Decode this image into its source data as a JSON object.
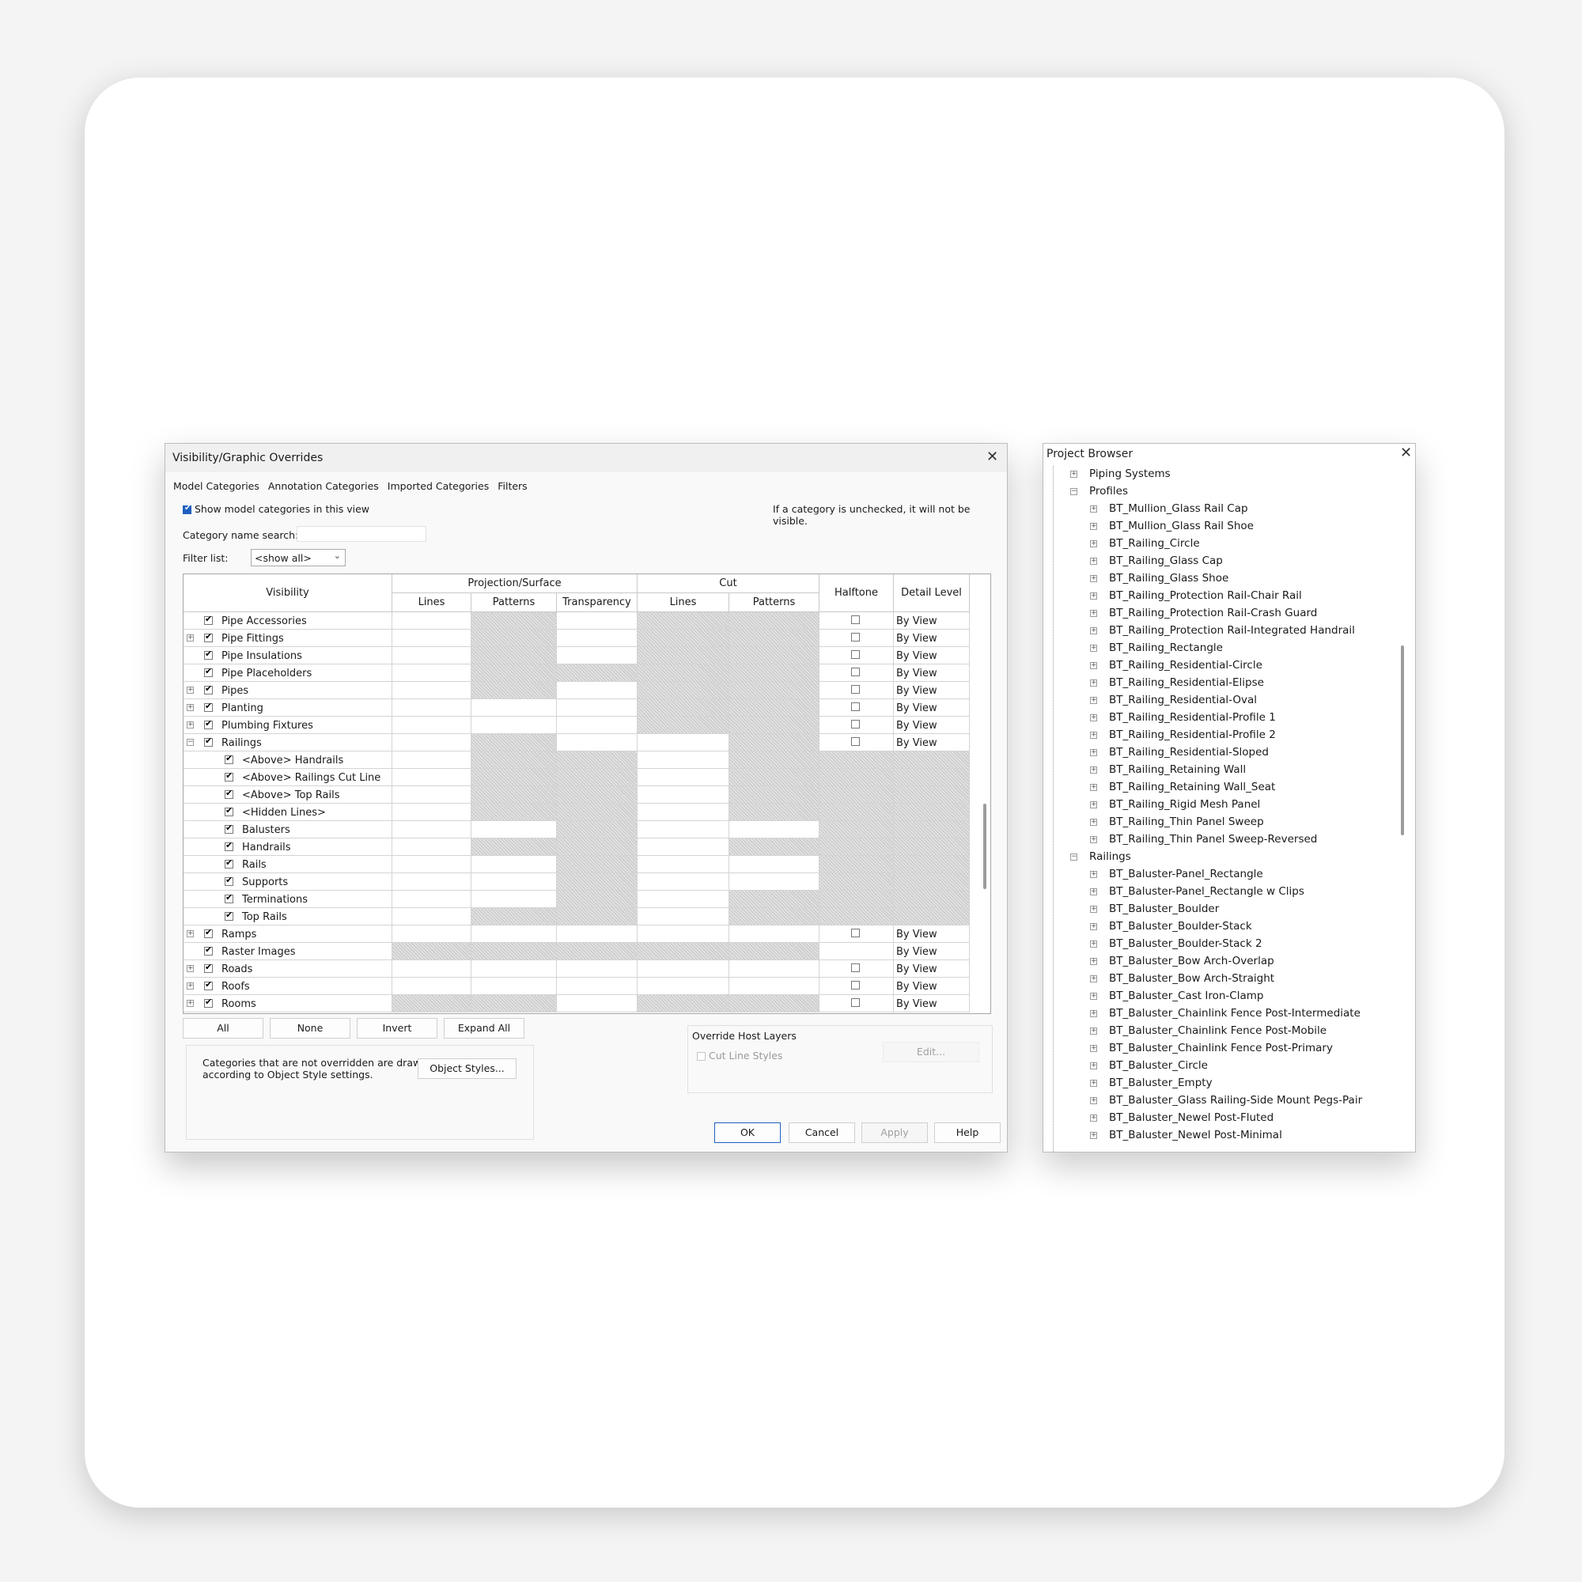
{
  "dialog": {
    "title": "Visibility/Graphic Overrides",
    "tabs": [
      "Model Categories",
      "Annotation Categories",
      "Imported Categories",
      "Filters"
    ],
    "show_model_label": "Show model categories in this view",
    "hint": "If a category is unchecked, it will not be visible.",
    "search_label": "Category name search:",
    "search_value": "",
    "filter_label": "Filter list:",
    "filter_value": "<show all>",
    "headers": {
      "visibility": "Visibility",
      "projection": "Projection/Surface",
      "cut": "Cut",
      "halftone": "Halftone",
      "detail": "Detail Level",
      "lines": "Lines",
      "patterns": "Patterns",
      "transparency": "Transparency"
    },
    "rows": [
      {
        "name": "Pipe Accessories",
        "level": 0,
        "exp": "",
        "dl": "By View",
        "hatch": [
          0,
          1,
          0,
          1,
          1
        ],
        "ht": true
      },
      {
        "name": "Pipe Fittings",
        "level": 0,
        "exp": "+",
        "dl": "By View",
        "hatch": [
          0,
          1,
          0,
          1,
          1
        ],
        "ht": true
      },
      {
        "name": "Pipe Insulations",
        "level": 0,
        "exp": "",
        "dl": "By View",
        "hatch": [
          0,
          1,
          0,
          1,
          1
        ],
        "ht": true
      },
      {
        "name": "Pipe Placeholders",
        "level": 0,
        "exp": "",
        "dl": "By View",
        "hatch": [
          0,
          1,
          1,
          1,
          1
        ],
        "ht": true
      },
      {
        "name": "Pipes",
        "level": 0,
        "exp": "+",
        "dl": "By View",
        "hatch": [
          0,
          1,
          0,
          1,
          1
        ],
        "ht": true
      },
      {
        "name": "Planting",
        "level": 0,
        "exp": "+",
        "dl": "By View",
        "hatch": [
          0,
          0,
          0,
          1,
          1
        ],
        "ht": true
      },
      {
        "name": "Plumbing Fixtures",
        "level": 0,
        "exp": "+",
        "dl": "By View",
        "hatch": [
          0,
          0,
          0,
          1,
          1
        ],
        "ht": true
      },
      {
        "name": "Railings",
        "level": 0,
        "exp": "-",
        "dl": "By View",
        "hatch": [
          0,
          1,
          0,
          0,
          1
        ],
        "ht": true
      },
      {
        "name": "<Above> Handrails",
        "level": 1,
        "exp": "",
        "dl": "",
        "hatch": [
          0,
          1,
          1,
          0,
          1,
          1,
          1
        ]
      },
      {
        "name": "<Above> Railings Cut Line",
        "level": 1,
        "exp": "",
        "dl": "",
        "hatch": [
          0,
          1,
          1,
          0,
          1,
          1,
          1
        ]
      },
      {
        "name": "<Above> Top Rails",
        "level": 1,
        "exp": "",
        "dl": "",
        "hatch": [
          0,
          1,
          1,
          0,
          1,
          1,
          1
        ]
      },
      {
        "name": "<Hidden Lines>",
        "level": 1,
        "exp": "",
        "dl": "",
        "hatch": [
          0,
          1,
          1,
          0,
          1,
          1,
          1
        ]
      },
      {
        "name": "Balusters",
        "level": 1,
        "exp": "",
        "dl": "",
        "hatch": [
          0,
          0,
          1,
          0,
          0,
          1,
          1
        ]
      },
      {
        "name": "Handrails",
        "level": 1,
        "exp": "",
        "dl": "",
        "hatch": [
          0,
          1,
          1,
          0,
          1,
          1,
          1
        ]
      },
      {
        "name": "Rails",
        "level": 1,
        "exp": "",
        "dl": "",
        "hatch": [
          0,
          0,
          1,
          0,
          0,
          1,
          1
        ]
      },
      {
        "name": "Supports",
        "level": 1,
        "exp": "",
        "dl": "",
        "hatch": [
          0,
          0,
          1,
          0,
          0,
          1,
          1
        ]
      },
      {
        "name": "Terminations",
        "level": 1,
        "exp": "",
        "dl": "",
        "hatch": [
          0,
          0,
          1,
          0,
          1,
          1,
          1
        ]
      },
      {
        "name": "Top Rails",
        "level": 1,
        "exp": "",
        "dl": "",
        "hatch": [
          0,
          1,
          1,
          0,
          1,
          1,
          1
        ]
      },
      {
        "name": "Ramps",
        "level": 0,
        "exp": "+",
        "dl": "By View",
        "hatch": [
          0,
          0,
          0,
          0,
          0
        ],
        "ht": true
      },
      {
        "name": "Raster Images",
        "level": 0,
        "exp": "",
        "dl": "By View",
        "hatch": [
          1,
          1,
          1,
          1,
          1,
          1
        ],
        "ht": false
      },
      {
        "name": "Roads",
        "level": 0,
        "exp": "+",
        "dl": "By View",
        "hatch": [
          0,
          0,
          0,
          0,
          0
        ],
        "ht": true
      },
      {
        "name": "Roofs",
        "level": 0,
        "exp": "+",
        "dl": "By View",
        "hatch": [
          0,
          0,
          0,
          0,
          0
        ],
        "ht": true
      },
      {
        "name": "Rooms",
        "level": 0,
        "exp": "+",
        "dl": "By View",
        "hatch": [
          1,
          1,
          0,
          1,
          1
        ],
        "ht": true
      }
    ],
    "buttons": {
      "all": "All",
      "none": "None",
      "invert": "Invert",
      "expand": "Expand All"
    },
    "note": [
      "Categories that are not overridden are drawn",
      "according to Object Style settings."
    ],
    "object_styles": "Object Styles...",
    "override_title": "Override Host Layers",
    "cut_line_styles": "Cut Line Styles",
    "edit": "Edit...",
    "footer": {
      "ok": "OK",
      "cancel": "Cancel",
      "apply": "Apply",
      "help": "Help"
    }
  },
  "browser": {
    "title": "Project Browser",
    "items": [
      {
        "label": "Piping Systems",
        "level": 0,
        "exp": "+"
      },
      {
        "label": "Profiles",
        "level": 0,
        "exp": "-"
      },
      {
        "label": "BT_Mullion_Glass Rail Cap",
        "level": 1,
        "exp": "+"
      },
      {
        "label": "BT_Mullion_Glass Rail Shoe",
        "level": 1,
        "exp": "+"
      },
      {
        "label": "BT_Railing_Circle",
        "level": 1,
        "exp": "+"
      },
      {
        "label": "BT_Railing_Glass Cap",
        "level": 1,
        "exp": "+"
      },
      {
        "label": "BT_Railing_Glass Shoe",
        "level": 1,
        "exp": "+"
      },
      {
        "label": "BT_Railing_Protection Rail-Chair Rail",
        "level": 1,
        "exp": "+"
      },
      {
        "label": "BT_Railing_Protection Rail-Crash Guard",
        "level": 1,
        "exp": "+"
      },
      {
        "label": "BT_Railing_Protection Rail-Integrated Handrail",
        "level": 1,
        "exp": "+"
      },
      {
        "label": "BT_Railing_Rectangle",
        "level": 1,
        "exp": "+"
      },
      {
        "label": "BT_Railing_Residential-Circle",
        "level": 1,
        "exp": "+"
      },
      {
        "label": "BT_Railing_Residential-Elipse",
        "level": 1,
        "exp": "+"
      },
      {
        "label": "BT_Railing_Residential-Oval",
        "level": 1,
        "exp": "+"
      },
      {
        "label": "BT_Railing_Residential-Profile 1",
        "level": 1,
        "exp": "+"
      },
      {
        "label": "BT_Railing_Residential-Profile 2",
        "level": 1,
        "exp": "+"
      },
      {
        "label": "BT_Railing_Residential-Sloped",
        "level": 1,
        "exp": "+"
      },
      {
        "label": "BT_Railing_Retaining Wall",
        "level": 1,
        "exp": "+"
      },
      {
        "label": "BT_Railing_Retaining Wall_Seat",
        "level": 1,
        "exp": "+"
      },
      {
        "label": "BT_Railing_Rigid Mesh Panel",
        "level": 1,
        "exp": "+"
      },
      {
        "label": "BT_Railing_Thin Panel Sweep",
        "level": 1,
        "exp": "+"
      },
      {
        "label": "BT_Railing_Thin Panel Sweep-Reversed",
        "level": 1,
        "exp": "+"
      },
      {
        "label": "Railings",
        "level": 0,
        "exp": "-"
      },
      {
        "label": "BT_Baluster-Panel_Rectangle",
        "level": 1,
        "exp": "+"
      },
      {
        "label": "BT_Baluster-Panel_Rectangle w Clips",
        "level": 1,
        "exp": "+"
      },
      {
        "label": "BT_Baluster_Boulder",
        "level": 1,
        "exp": "+"
      },
      {
        "label": "BT_Baluster_Boulder-Stack",
        "level": 1,
        "exp": "+"
      },
      {
        "label": "BT_Baluster_Boulder-Stack 2",
        "level": 1,
        "exp": "+"
      },
      {
        "label": "BT_Baluster_Bow Arch-Overlap",
        "level": 1,
        "exp": "+"
      },
      {
        "label": "BT_Baluster_Bow Arch-Straight",
        "level": 1,
        "exp": "+"
      },
      {
        "label": "BT_Baluster_Cast Iron-Clamp",
        "level": 1,
        "exp": "+"
      },
      {
        "label": "BT_Baluster_Chainlink Fence Post-Intermediate",
        "level": 1,
        "exp": "+"
      },
      {
        "label": "BT_Baluster_Chainlink Fence Post-Mobile",
        "level": 1,
        "exp": "+"
      },
      {
        "label": "BT_Baluster_Chainlink Fence Post-Primary",
        "level": 1,
        "exp": "+"
      },
      {
        "label": "BT_Baluster_Circle",
        "level": 1,
        "exp": "+"
      },
      {
        "label": "BT_Baluster_Empty",
        "level": 1,
        "exp": "+"
      },
      {
        "label": "BT_Baluster_Glass Railing-Side Mount Pegs-Pair",
        "level": 1,
        "exp": "+"
      },
      {
        "label": "BT_Baluster_Newel Post-Fluted",
        "level": 1,
        "exp": "+"
      },
      {
        "label": "BT_Baluster_Newel Post-Minimal",
        "level": 1,
        "exp": "+"
      }
    ]
  }
}
